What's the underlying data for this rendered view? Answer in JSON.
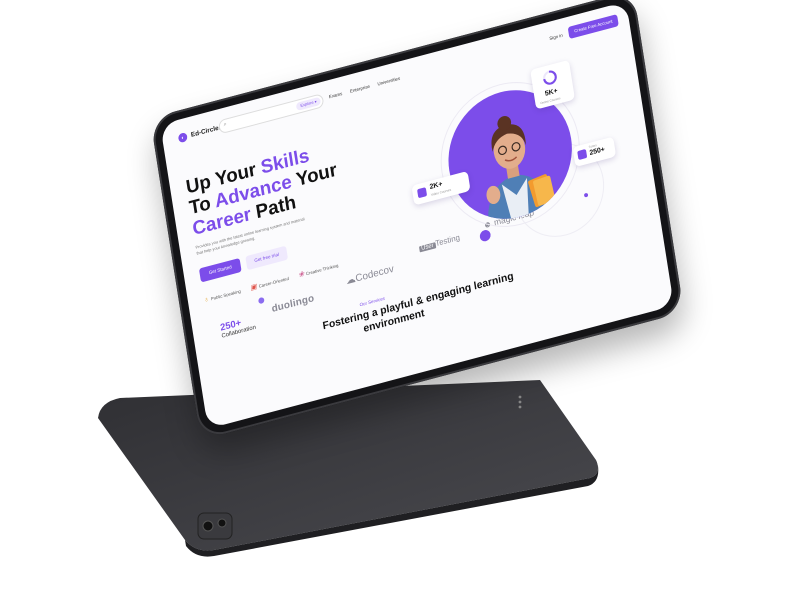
{
  "brand": {
    "logo_text": "Ed-Circle."
  },
  "nav": {
    "explore_label": "Explore",
    "links": [
      "Exams",
      "Enterprise",
      "Universities"
    ],
    "signin_label": "Sign in",
    "cta_label": "Create Free Account"
  },
  "hero": {
    "title_part1": "Up Your ",
    "title_accent1": "Skills",
    "title_part2": "To ",
    "title_accent2": "Advance",
    "title_part3": " Your",
    "title_accent3": "Career",
    "title_part4": " Path",
    "description": "Provides you with the latest online learning system and material that help your knowledge growing.",
    "primary_button": "Get Started",
    "secondary_button": "Get free trial",
    "categories": [
      "Public Speaking",
      "Career-Oriented",
      "Creative Thinking"
    ]
  },
  "stats": {
    "collab_value": "250+",
    "collab_label": "Collaboration",
    "card_2k_value": "2K+",
    "card_2k_label": "Video Courses",
    "card_5k_value": "5K+",
    "card_5k_label": "Online Courses",
    "card_250_value": "250+",
    "card_250_label": "Tutors"
  },
  "partners": {
    "duolingo": "duolingo",
    "codecov": "Codecov",
    "usertesting_box": "User",
    "usertesting_rest": "Testing",
    "magicleap": "magic leap"
  },
  "services": {
    "eyebrow": "Our Services",
    "heading_line1": "Fostering a playful & engaging learning",
    "heading_line2": "environment"
  },
  "colors": {
    "accent": "#7c4dea",
    "device": "#3b3b3f"
  }
}
